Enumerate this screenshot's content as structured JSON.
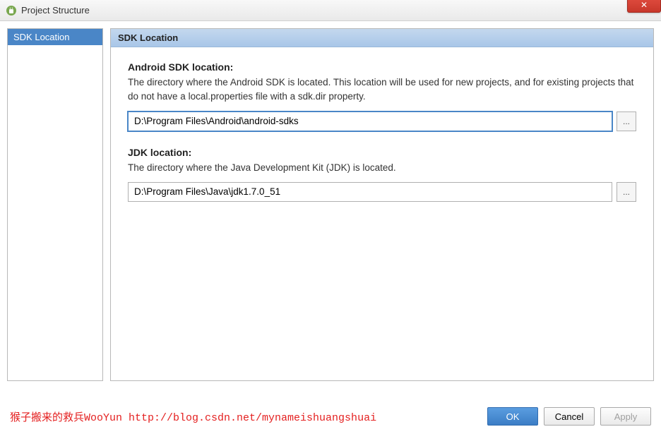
{
  "window": {
    "title": "Project Structure",
    "close_label": "✕"
  },
  "sidebar": {
    "items": [
      {
        "label": "SDK Location",
        "selected": true
      }
    ]
  },
  "main": {
    "header": "SDK Location",
    "sections": [
      {
        "title": "Android SDK location:",
        "desc": "The directory where the Android SDK is located. This location will be used for new projects, and for existing projects that do not have a local.properties file with a sdk.dir property.",
        "value": "D:\\Program Files\\Android\\android-sdks",
        "browse": "...",
        "focused": true
      },
      {
        "title": "JDK location:",
        "desc": "The directory where the Java Development Kit (JDK) is located.",
        "value": "D:\\Program Files\\Java\\jdk1.7.0_51",
        "browse": "...",
        "focused": false
      }
    ]
  },
  "footer": {
    "watermark": "猴子搬来的救兵WooYun http://blog.csdn.net/mynameishuangshuai",
    "ok": "OK",
    "cancel": "Cancel",
    "apply": "Apply"
  }
}
